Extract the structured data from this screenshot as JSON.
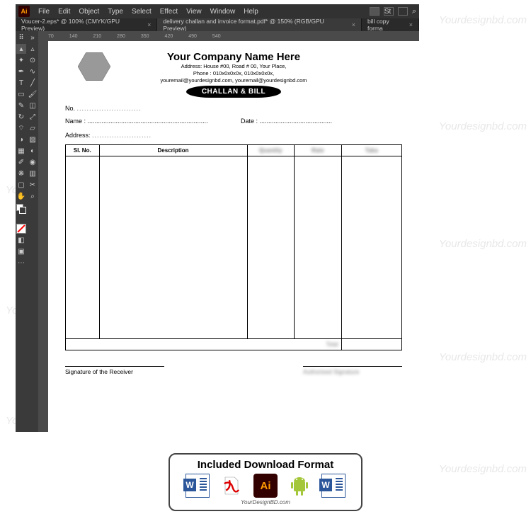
{
  "watermark": "Yourdesignbd.com",
  "app": {
    "menu": [
      "File",
      "Edit",
      "Object",
      "Type",
      "Select",
      "Effect",
      "View",
      "Window",
      "Help"
    ],
    "tabs": [
      {
        "label": "Voucer-2.eps* @ 100% (CMYK/GPU Preview)",
        "active": false
      },
      {
        "label": "delivery challan and invoice format.pdf* @ 150% (RGB/GPU Preview)",
        "active": true
      },
      {
        "label": "bill copy forma",
        "active": false
      }
    ],
    "ruler_marks": [
      "70",
      "140",
      "210",
      "280",
      "350",
      "420",
      "490",
      "540"
    ]
  },
  "doc": {
    "company": "Your Company Name Here",
    "addr1": "Address: House #00, Road # 00, Your Place,",
    "addr2": "Phone : 010x0x0x0x, 010x0x0x0x,",
    "addr3": "youremail@yourdesignbd.com, youremail@yourdesignbd.com",
    "stamp": "CHALLAN & BILL",
    "no_label": "No.",
    "name_label": "Name :",
    "date_label": "Date :",
    "address_label": "Address:",
    "cols": {
      "sl": "Sl. No.",
      "desc": "Description",
      "qty": "Quantity",
      "rate": "Rate",
      "taka": "Taka"
    },
    "total": "Total",
    "sig_receiver": "Signature of the Receiver",
    "sig_auth": "Authorised Signature"
  },
  "download": {
    "title": "Included Download Format",
    "site": "YourDesignBD.com",
    "icons": {
      "word": "W",
      "pdf": "PDF",
      "ai": "Ai",
      "android": "android",
      "word2": "W"
    }
  }
}
